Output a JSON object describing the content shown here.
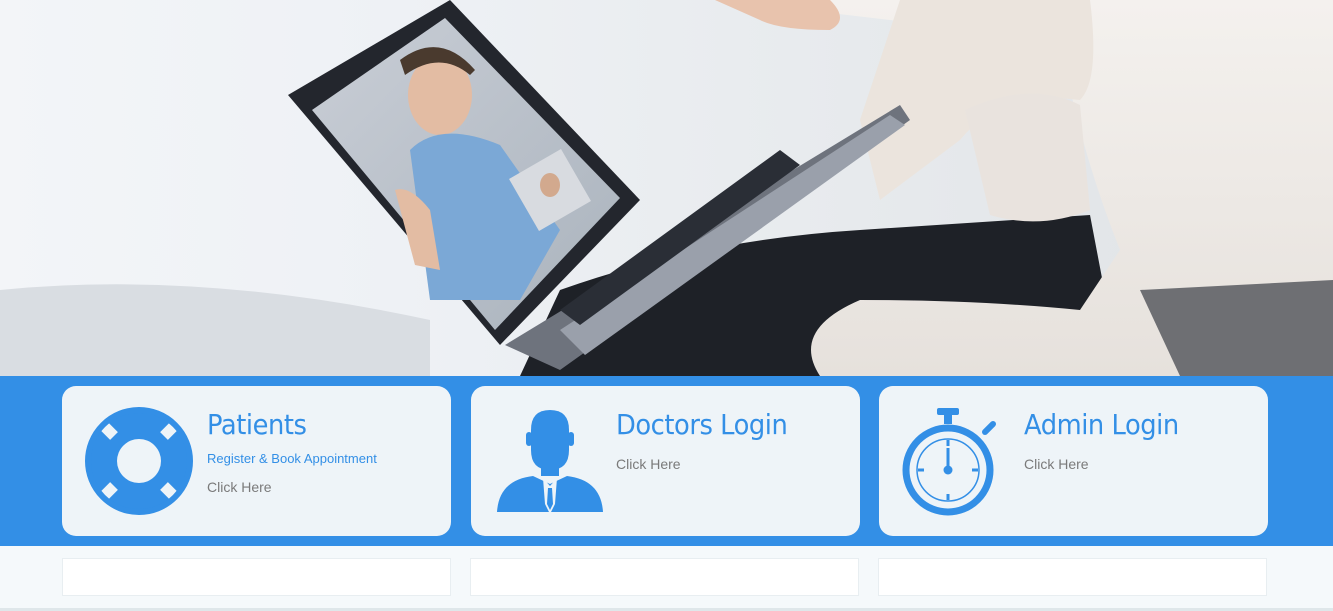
{
  "hero": {
    "image_alt": "Patient on a video call with a doctor on a laptop"
  },
  "cards": [
    {
      "title": "Patients",
      "subtitle": "Register & Book Appointment",
      "link": "Click Here",
      "icon": "lifebuoy-icon"
    },
    {
      "title": "Doctors Login",
      "link": "Click Here",
      "icon": "doctor-icon"
    },
    {
      "title": "Admin Login",
      "link": "Click Here",
      "icon": "stopwatch-icon"
    }
  ],
  "colors": {
    "accent": "#338fe6",
    "card_bg": "#eef4f8",
    "link_gray": "#7a7a7a"
  }
}
